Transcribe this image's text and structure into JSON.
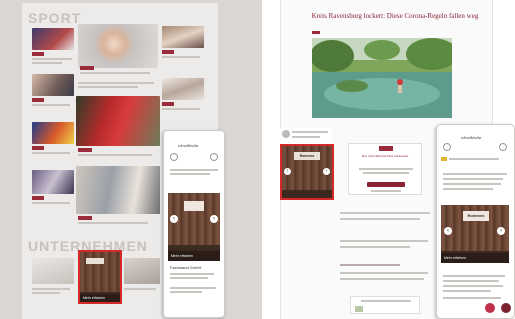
{
  "left": {
    "section_sport": "SPORT",
    "section_unternehmen": "UNTERNEHMEN",
    "phone": {
      "logo": "schwäbische",
      "ad_cta": "Mehr erfahren",
      "ad_name": "Fachstand GmbH"
    },
    "ad_tile": {
      "cta": "Mehr erfahren"
    }
  },
  "right": {
    "headline": "Kreis Ravensburg lockert: Diese Corona-Regeln fallen weg",
    "overlay": {
      "title": "Das Schwäbische Plus entdecken"
    },
    "phone": {
      "logo": "schwäbische",
      "ad_cta": "Mehr erfahren",
      "ad_brand": "Rommes"
    },
    "sidebar_ad": {
      "brand": "Rommes"
    }
  },
  "colors": {
    "accent": "#9b2a3a",
    "highlight": "#d62a2a",
    "wood": "#5b3a2a"
  }
}
